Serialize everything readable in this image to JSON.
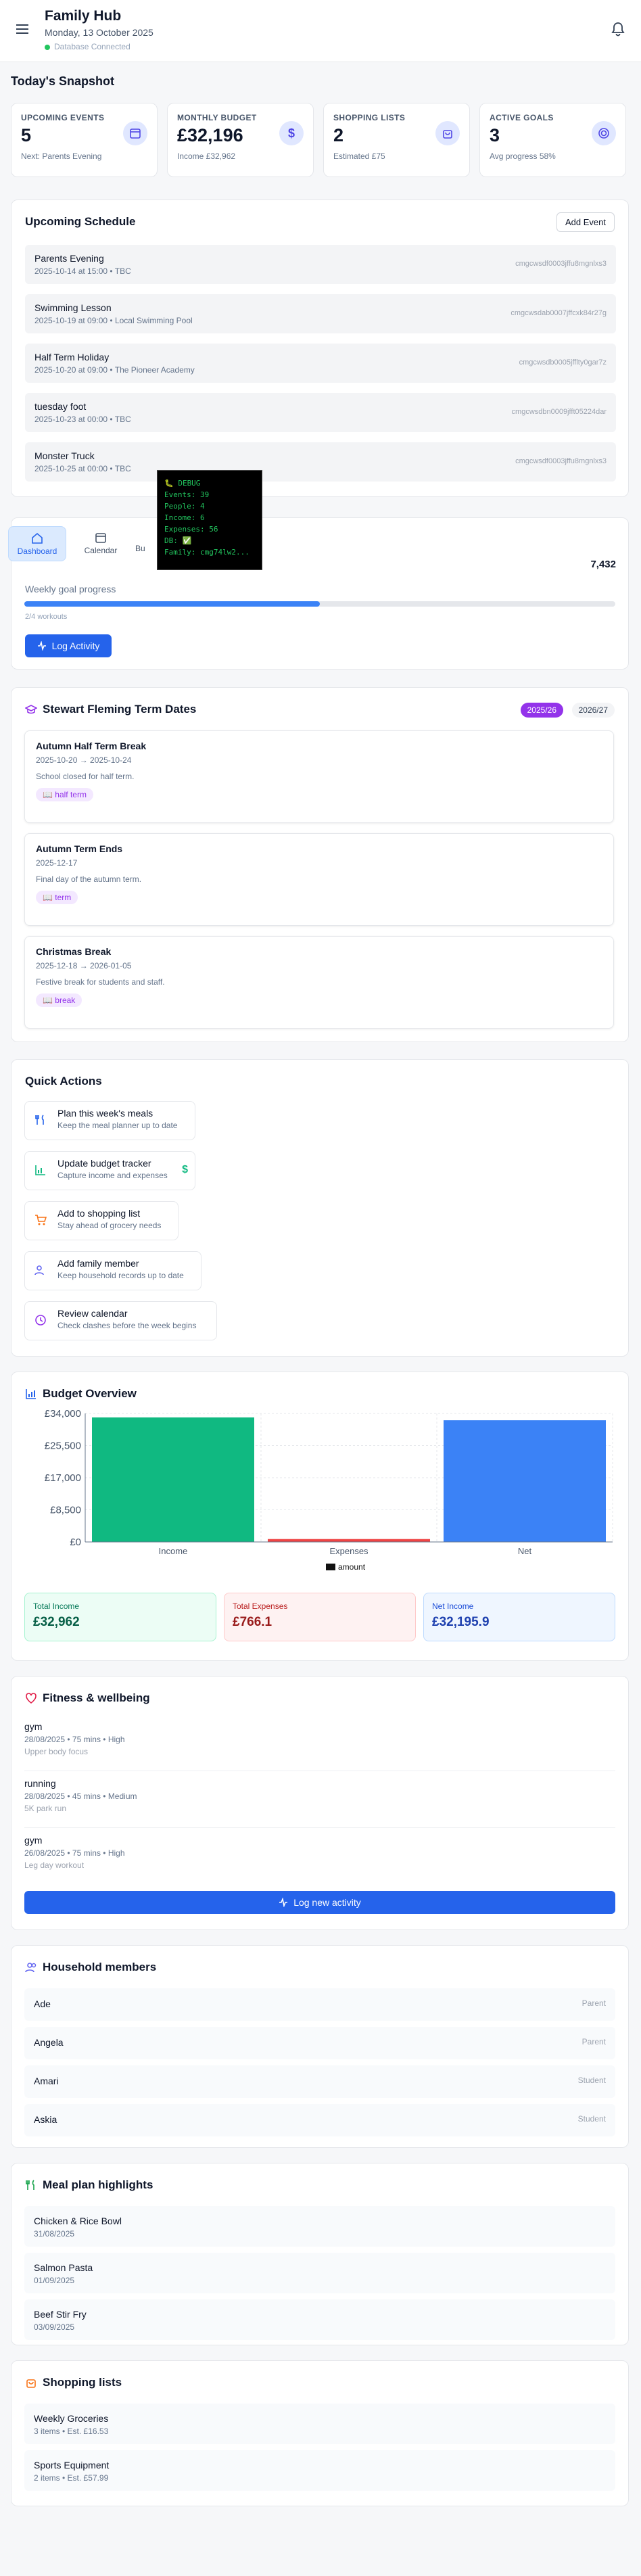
{
  "header": {
    "title": "Family Hub",
    "date": "Monday, 13 October 2025",
    "db_status": "Database Connected"
  },
  "snapshot": {
    "title": "Today's Snapshot",
    "cards": [
      {
        "label": "UPCOMING EVENTS",
        "value": "5",
        "sub": "Next: Parents Evening",
        "icon": "calendar-icon"
      },
      {
        "label": "MONTHLY BUDGET",
        "value": "£32,196",
        "sub": "Income £32,962",
        "icon": "dollar-icon"
      },
      {
        "label": "SHOPPING LISTS",
        "value": "2",
        "sub": "Estimated £75",
        "icon": "bag-icon"
      },
      {
        "label": "ACTIVE GOALS",
        "value": "3",
        "sub": "Avg progress 58%",
        "icon": "target-icon"
      }
    ]
  },
  "schedule": {
    "title": "Upcoming Schedule",
    "add_label": "Add Event",
    "items": [
      {
        "name": "Parents Evening",
        "detail": "2025-10-14 at 15:00 • TBC",
        "id": "cmgcwsdf0003jff​u8mgnlxs3"
      },
      {
        "name": "Swimming Lesson",
        "detail": "2025-10-19 at 09:00 • Local Swimming Pool",
        "id": "cmgcwsdab0007jff​cxk84r27g"
      },
      {
        "name": "Half Term Holiday",
        "detail": "2025-10-20 at 09:00 • The Pioneer Academy",
        "id": "cmgcwsdb0005jffl​ty0gar7z"
      },
      {
        "name": "tuesday foot",
        "detail": "2025-10-23 at 00:00 • TBC",
        "id": "cmgcwsdbn0009jff​t05224dar"
      },
      {
        "name": "Monster Truck",
        "detail": "2025-10-25 at 00:00 • TBC",
        "id": "cmgcwsdf0003jff​u8mgnlxs3"
      }
    ]
  },
  "debug": {
    "lines": [
      "🐛 DEBUG",
      "Events: 39",
      "People: 4",
      "Income: 6",
      "Expenses: 56",
      "DB: ✅",
      "Family: cmg74lw2..."
    ]
  },
  "nav": {
    "tabs": [
      {
        "label": "Dashboard",
        "icon": "home-icon"
      },
      {
        "label": "Calendar",
        "icon": "calendar-icon"
      },
      {
        "label": "Bu",
        "icon": "budget-icon"
      }
    ]
  },
  "activity": {
    "steps_value": "7,432",
    "goal_label": "Weekly goal progress",
    "workouts": "2/4 workouts",
    "progress": 0.5,
    "log_label": "Log Activity"
  },
  "term": {
    "title": "Stewart Fleming Term Dates",
    "years": [
      "2025/26",
      "2026/27"
    ],
    "items": [
      {
        "name": "Autumn Half Term Break",
        "dates": "2025-10-20 → 2025-10-24",
        "desc": "School closed for half term.",
        "tag": "half term"
      },
      {
        "name": "Autumn Term Ends",
        "dates": "2025-12-17",
        "desc": "Final day of the autumn term.",
        "tag": "term"
      },
      {
        "name": "Christmas Break",
        "dates": "2025-12-18 → 2026-01-05",
        "desc": "Festive break for students and staff.",
        "tag": "break"
      }
    ]
  },
  "quick": {
    "title": "Quick Actions",
    "items": [
      {
        "name": "Plan this week's meals",
        "sub": "Keep the meal planner up to date",
        "icon": "utensils-icon"
      },
      {
        "name": "Update budget tracker",
        "sub": "Capture income and expenses",
        "icon": "chart-icon"
      },
      {
        "name": "Add to shopping list",
        "sub": "Stay ahead of grocery needs",
        "icon": "cart-icon"
      },
      {
        "name": "Add family member",
        "sub": "Keep household records up to date",
        "icon": "users-icon"
      },
      {
        "name": "Review calendar",
        "sub": "Check clashes before the week begins",
        "icon": "clock-icon"
      }
    ]
  },
  "chart_data": {
    "type": "bar",
    "title": "Budget Overview",
    "categories": [
      "Income",
      "Expenses",
      "Net"
    ],
    "values": [
      32962,
      766.1,
      32195.9
    ],
    "colors": [
      "#10b981",
      "#ef4444",
      "#3b82f6"
    ],
    "series_name": "amount",
    "ylim": [
      0,
      34000
    ],
    "yticks": [
      "£0",
      "£8,500",
      "£17,000",
      "£25,500",
      "£34,000"
    ],
    "grid": true,
    "legend": "bottom"
  },
  "totals": [
    {
      "label": "Total Income",
      "value": "£32,962"
    },
    {
      "label": "Total Expenses",
      "value": "£766.1"
    },
    {
      "label": "Net Income",
      "value": "£32,195.9"
    }
  ],
  "fitness": {
    "title": "Fitness & wellbeing",
    "items": [
      {
        "name": "gym",
        "meta": "28/08/2025 • 75 mins • High",
        "note": "Upper body focus"
      },
      {
        "name": "running",
        "meta": "28/08/2025 • 45 mins • Medium",
        "note": "5K park run"
      },
      {
        "name": "gym",
        "meta": "26/08/2025 • 75 mins • High",
        "note": "Leg day workout"
      }
    ],
    "log_label": "Log new activity"
  },
  "members": {
    "title": "Household members",
    "items": [
      {
        "name": "Ade",
        "role": "Parent"
      },
      {
        "name": "Angela",
        "role": "Parent"
      },
      {
        "name": "Amari",
        "role": "Student"
      },
      {
        "name": "Askia",
        "role": "Student"
      }
    ]
  },
  "meals": {
    "title": "Meal plan highlights",
    "items": [
      {
        "name": "Chicken & Rice Bowl",
        "date": "31/08/2025"
      },
      {
        "name": "Salmon Pasta",
        "date": "01/09/2025"
      },
      {
        "name": "Beef Stir Fry",
        "date": "03/09/2025"
      }
    ]
  },
  "shopping": {
    "title": "Shopping lists",
    "items": [
      {
        "name": "Weekly Groceries",
        "meta": "3 items • Est. £16.53"
      },
      {
        "name": "Sports Equipment",
        "meta": "2 items • Est. £57.99"
      }
    ]
  }
}
